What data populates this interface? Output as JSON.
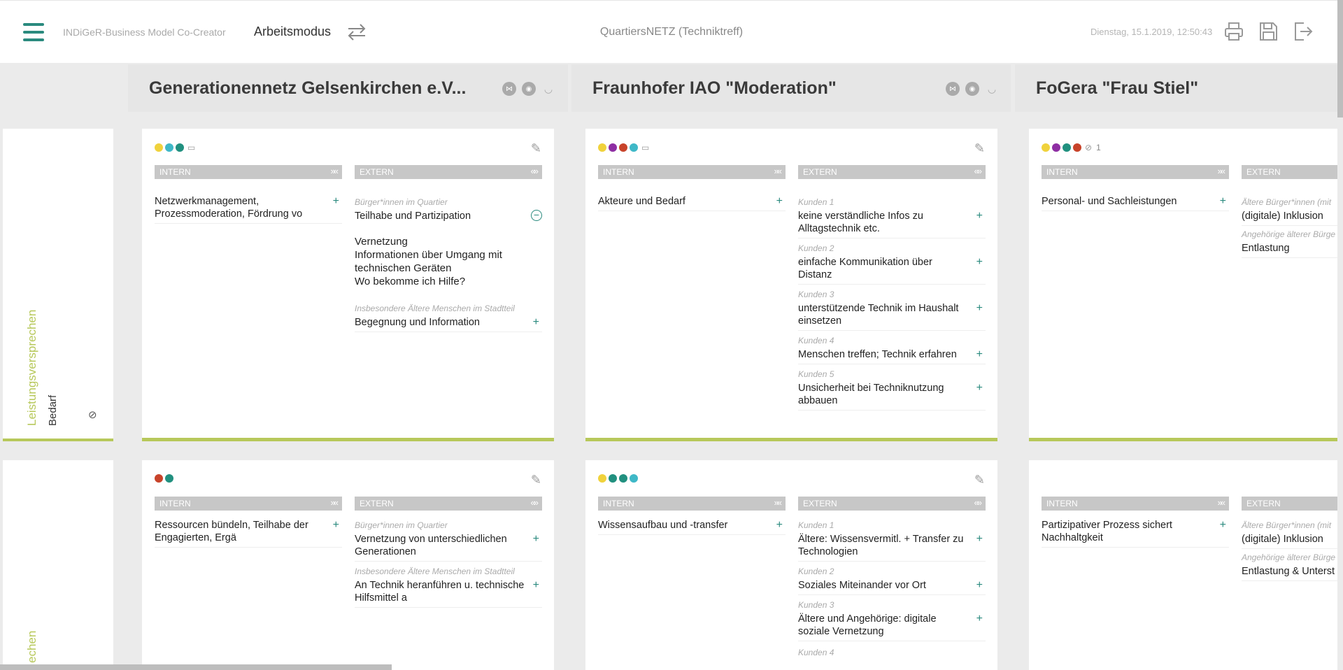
{
  "header": {
    "app_name": "INDiGeR-Business Model Co-Creator",
    "mode_label": "Arbeitsmodus",
    "project_title": "QuartiersNETZ (Techniktreff)",
    "datetime": "Dienstag, 15.1.2019, 12:50:43",
    "icons": [
      "menu-icon",
      "swap-arrows-icon",
      "print-icon",
      "save-icon",
      "logout-icon"
    ]
  },
  "columns": [
    {
      "title": "Generationennetz Gelsenkirchen e.V..."
    },
    {
      "title": "Fraunhofer IAO \"Moderation\""
    },
    {
      "title": "FoGera \"Frau Stiel\""
    }
  ],
  "rows": [
    {
      "label_main": "Leistungsversprechen",
      "label_sub": "Bedarf"
    },
    {
      "label_main": "echen"
    }
  ],
  "tabs": {
    "intern": "INTERN",
    "extern": "EXTERN"
  },
  "colors": {
    "accent": "#b7c85a",
    "teal": "#2a8a7e",
    "yellow": "#f0d23c",
    "cyan": "#3fb8c7",
    "purple": "#8e2ea3",
    "red": "#c8432a",
    "green": "#21907f"
  },
  "cells": {
    "r1c1": {
      "counts_label": "",
      "intern": "Netzwerkmanagement, Prozessmoderation, Fördrung vo",
      "extern_group1": "Bürger*innen im Quartier",
      "extern_item1": "Teilhabe und Partizipation",
      "note_lines": [
        "Vernetzung",
        "Informationen über Umgang mit",
        "technischen Geräten",
        "Wo bekomme ich Hilfe?"
      ],
      "extern_group2": "Insbesondere Ältere Menschen im Stadtteil",
      "extern_item2": "Begegnung und Information"
    },
    "r1c2": {
      "intern": "Akteure und Bedarf",
      "k1": "Kunden 1",
      "k1_text": "keine verständliche Infos zu Alltagstechnik etc.",
      "k2": "Kunden 2",
      "k2_text": "einfache Kommunikation über Distanz",
      "k3": "Kunden 3",
      "k3_text": "unterstützende Technik im Haushalt einsetzen",
      "k4": "Kunden 4",
      "k4_text": "Menschen treffen; Technik erfahren",
      "k5": "Kunden 5",
      "k5_text": "Unsicherheit bei Techniknutzung abbauen"
    },
    "r1c3": {
      "link_count": "1",
      "intern": "Personal- und Sachleistungen",
      "g1": "Ältere Bürger*innen (mit",
      "g1_text": "(digitale) Inklusion",
      "g2": "Angehörige älterer Bürge",
      "g2_text": "Entlastung"
    },
    "r2c1": {
      "intern": "Ressourcen bündeln, Teilhabe der Engagierten, Ergä",
      "g1": "Bürger*innen im Quartier",
      "g1_text": "Vernetzung von unterschiedlichen Generationen",
      "g2": "Insbesondere Ältere Menschen im Stadtteil",
      "g2_text": "An Technik heranführen u. technische Hilfsmittel a"
    },
    "r2c2": {
      "intern": "Wissensaufbau und -transfer",
      "k1": "Kunden 1",
      "k1_text": "Ältere: Wissensvermitl. + Transfer zu Technologien",
      "k2": "Kunden 2",
      "k2_text": "Soziales Miteinander vor Ort",
      "k3": "Kunden 3",
      "k3_text": "Ältere und Angehörige: digitale soziale Vernetzung",
      "k4": "Kunden 4"
    },
    "r2c3": {
      "intern": "Partizipativer Prozess sichert Nachhaltgkeit",
      "g1": "Ältere Bürger*innen (mit",
      "g1_text": "(digitale) Inklusion",
      "g2": "Angehörige älterer Bürge",
      "g2_text": "Entlastung & Unterst"
    }
  }
}
